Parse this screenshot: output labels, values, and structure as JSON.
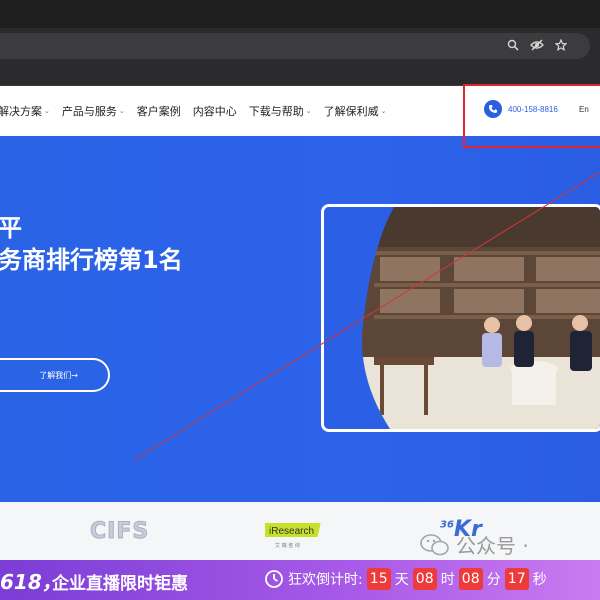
{
  "browser": {
    "icons": [
      "zoom-icon",
      "eye-slash-icon",
      "star-icon"
    ]
  },
  "header": {
    "nav": [
      {
        "label": "解决方案",
        "caret": "⌄"
      },
      {
        "label": "产品与服务",
        "caret": "⌄"
      },
      {
        "label": "客户案例",
        "caret": ""
      },
      {
        "label": "内容中心",
        "caret": ""
      },
      {
        "label": "下载与帮助",
        "caret": "⌄"
      },
      {
        "label": "了解保利威",
        "caret": "⌄"
      }
    ],
    "phone": "400-158-8816",
    "lang": "En"
  },
  "hero": {
    "title_line1": "平",
    "title_line2": "务商排行榜第1名",
    "button_label": "了解我们→"
  },
  "logos": {
    "cifs": "CIFS",
    "iresearch": "iResearch",
    "iresearch_sub": "艾 瑞 咨 询",
    "kr36_num": "36",
    "kr36_text": "Kr"
  },
  "watermark": "公众号 ·",
  "promo": {
    "tag": "618，",
    "title": "企业直播限时钜惠",
    "countdown_label": "狂欢倒计时:",
    "days": "15",
    "days_unit": "天",
    "hours": "08",
    "hours_unit": "时",
    "minutes": "08",
    "minutes_unit": "分",
    "seconds": "17",
    "seconds_unit": "秒"
  },
  "colors": {
    "brand_blue": "#2a63e6",
    "highlight_red": "#e0262b",
    "countdown_red": "#ef3a3a",
    "promo_purple": "#7b3dd6"
  }
}
